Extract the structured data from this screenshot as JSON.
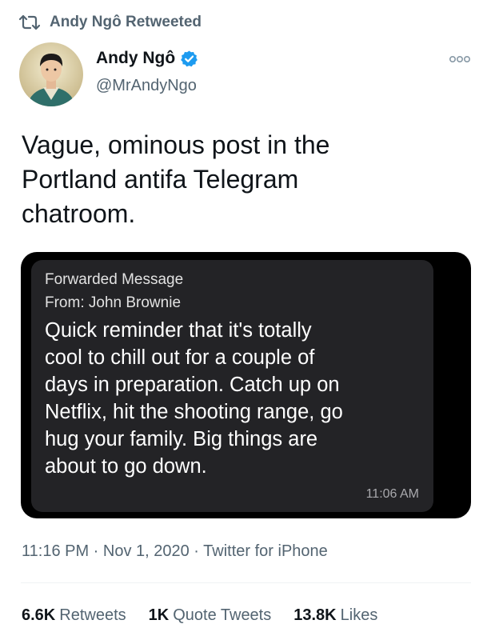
{
  "retweet": {
    "label": "Andy Ngô Retweeted"
  },
  "author": {
    "name": "Andy Ngô",
    "handle": "@MrAndyNgo",
    "verified": true,
    "verified_color": "#1d9bf0"
  },
  "tweet": {
    "text_lines": [
      "Vague, ominous post in the",
      "Portland antifa Telegram",
      "chatroom."
    ]
  },
  "media": {
    "forwarded_label": "Forwarded Message",
    "from_label": "From: John Brownie",
    "message_lines": [
      "Quick reminder that it's totally",
      "cool to chill out for a couple of",
      "days in preparation. Catch up on",
      "Netflix, hit the shooting range, go",
      "hug your family. Big things are",
      "about to go down."
    ],
    "message_time": "11:06 AM"
  },
  "meta": {
    "timestamp": "11:16 PM · Nov 1, 2020 · Twitter for iPhone"
  },
  "stats": {
    "retweets_count": "6.6K",
    "retweets_label": "Retweets",
    "quotes_count": "1K",
    "quotes_label": "Quote Tweets",
    "likes_count": "13.8K",
    "likes_label": "Likes"
  },
  "colors": {
    "secondary_text": "#536471",
    "bubble_bg": "#232326",
    "media_bg": "#000000"
  }
}
